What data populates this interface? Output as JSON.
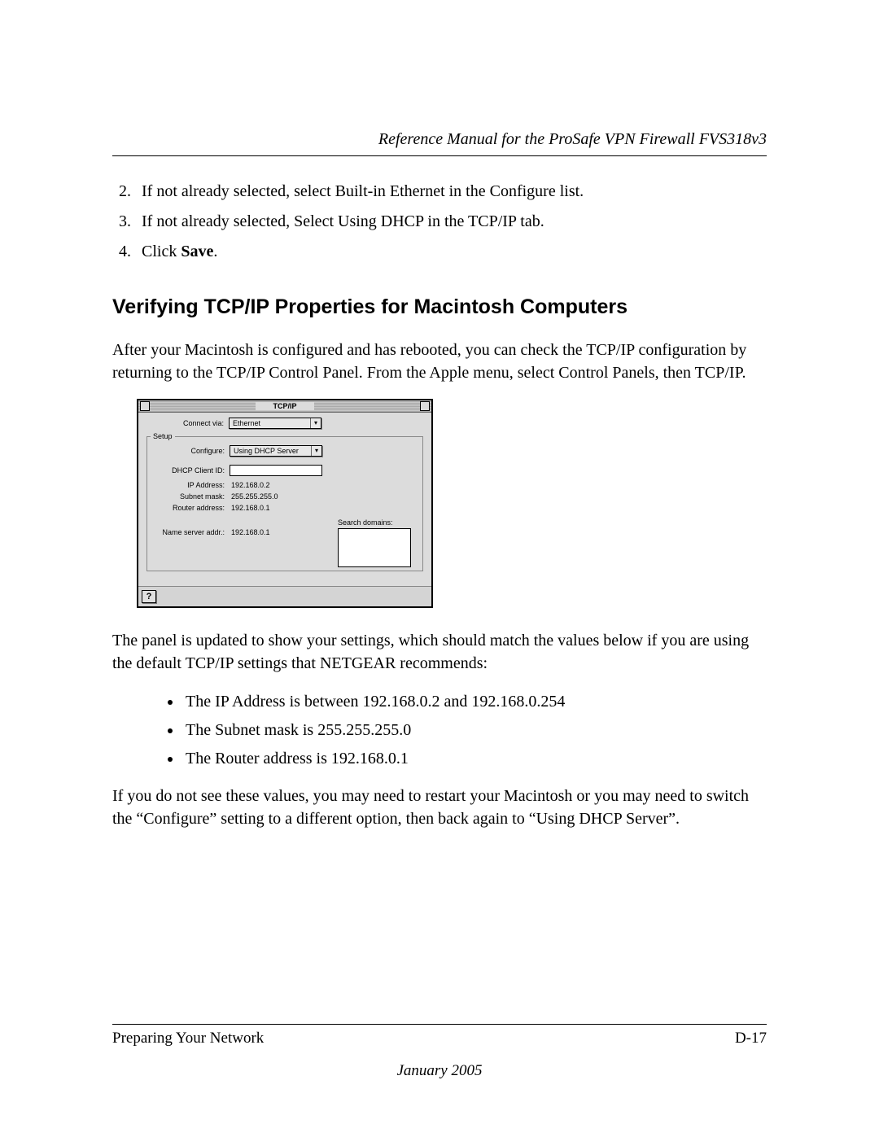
{
  "header": {
    "running_title": "Reference Manual for the ProSafe VPN Firewall FVS318v3"
  },
  "steps": {
    "s2": "If not already selected, select Built-in Ethernet in the Configure list.",
    "s3": "If not already selected, Select Using DHCP in the TCP/IP tab.",
    "s4_prefix": "Click ",
    "s4_bold": "Save",
    "s4_suffix": "."
  },
  "section_heading": "Verifying TCP/IP Properties for Macintosh Computers",
  "intro_para": "After your Macintosh is configured and has rebooted, you can check the TCP/IP configuration by returning to the TCP/IP Control Panel. From the Apple menu, select Control Panels, then TCP/IP.",
  "mac": {
    "title": "TCP/IP",
    "connect_via_label": "Connect via:",
    "connect_via_value": "Ethernet",
    "setup_legend": "Setup",
    "configure_label": "Configure:",
    "configure_value": "Using DHCP Server",
    "dhcp_client_label": "DHCP Client ID:",
    "ip_label": "IP Address:",
    "ip_value": "192.168.0.2",
    "subnet_label": "Subnet mask:",
    "subnet_value": "255.255.255.0",
    "router_label": "Router address:",
    "router_value": "192.168.0.1",
    "ns_label": "Name server addr.:",
    "ns_value": "192.168.0.1",
    "search_label": "Search domains:",
    "help_glyph": "?"
  },
  "after_para": "The panel is updated to show your settings, which should match the values below if you are using the default TCP/IP settings that NETGEAR recommends:",
  "bullets": {
    "b1": "The IP Address is between 192.168.0.2 and 192.168.0.254",
    "b2": "The Subnet mask is 255.255.255.0",
    "b3": "The Router address is 192.168.0.1"
  },
  "closing_para": "If you do not see these values, you may need to restart your Macintosh or you may need to switch the “Configure” setting to a different option, then back again to “Using DHCP Server”.",
  "footer": {
    "section": "Preparing Your Network",
    "page": "D-17",
    "date": "January 2005"
  }
}
